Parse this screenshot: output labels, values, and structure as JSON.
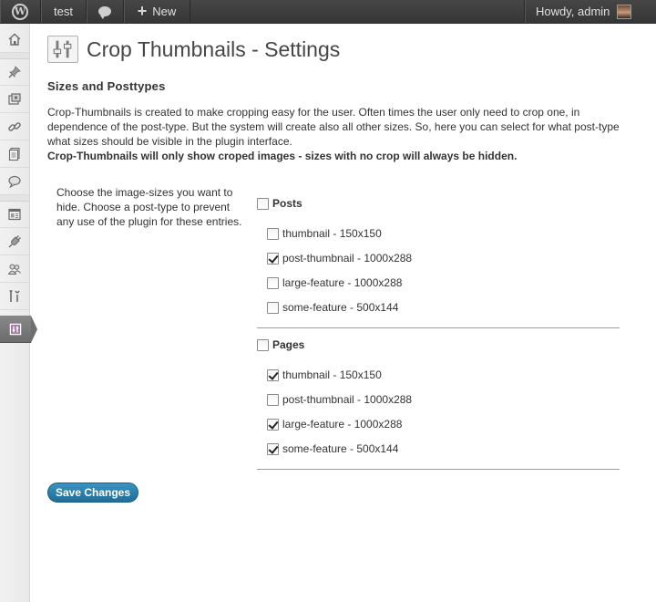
{
  "admin_bar": {
    "site_name": "test",
    "new_label": "New",
    "greeting": "Howdy, admin"
  },
  "side_menu": {
    "items": [
      {
        "icon": "dashboard-icon"
      },
      {
        "icon": "posts-pin-icon"
      },
      {
        "icon": "media-icon"
      },
      {
        "icon": "links-icon"
      },
      {
        "icon": "pages-icon"
      },
      {
        "icon": "comments-icon"
      },
      {
        "icon": "appearance-icon"
      },
      {
        "icon": "plugins-icon"
      },
      {
        "icon": "users-icon"
      },
      {
        "icon": "tools-icon"
      },
      {
        "icon": "settings-icon",
        "current": true
      }
    ]
  },
  "page": {
    "title": "Crop Thumbnails - Settings",
    "section_heading": "Sizes and Posttypes",
    "intro": "Crop-Thumbnails is created to make cropping easy for the user. Often times the user only need to crop one, in dependence of the post-type. But the system will create also all other sizes. So, here you can select for what post-type what sizes should be visible in the plugin interface.",
    "intro_bold": "Crop-Thumbnails will only show croped images - sizes with no crop will always be hidden.",
    "help_text": "Choose the image-sizes you want to hide. Choose a post-type to prevent any use of the plugin for these entries.",
    "save_label": "Save Changes"
  },
  "post_types": [
    {
      "label": "Posts",
      "checked": false,
      "sizes": [
        {
          "label": "thumbnail - 150x150",
          "checked": false
        },
        {
          "label": "post-thumbnail - 1000x288",
          "checked": true
        },
        {
          "label": "large-feature - 1000x288",
          "checked": false
        },
        {
          "label": "some-feature - 500x144",
          "checked": false
        }
      ]
    },
    {
      "label": "Pages",
      "checked": false,
      "sizes": [
        {
          "label": "thumbnail - 150x150",
          "checked": true
        },
        {
          "label": "post-thumbnail - 1000x288",
          "checked": false
        },
        {
          "label": "large-feature - 1000x288",
          "checked": true
        },
        {
          "label": "some-feature - 500x144",
          "checked": true
        }
      ]
    }
  ],
  "colors": {
    "admin_bar": "#464646",
    "button": "#2a81ad",
    "side_menu": "#efefef"
  }
}
